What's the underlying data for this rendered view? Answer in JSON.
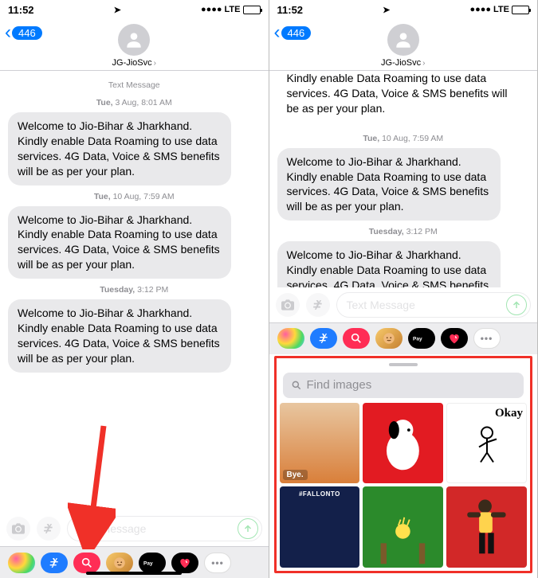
{
  "statusbar": {
    "time": "11:52",
    "network": "LTE"
  },
  "header": {
    "back_badge": "446",
    "contact_name": "JG-JioSvc"
  },
  "text_message_label": "Text Message",
  "timestamps": {
    "t1_day": "Tue,",
    "t1_rest": "3 Aug, 8:01 AM",
    "t2_day": "Tue,",
    "t2_rest": "10 Aug, 7:59 AM",
    "t3_day": "Tuesday,",
    "t3_rest": "3:12 PM"
  },
  "msg_body": "Welcome to Jio-Bihar & Jharkhand. Kindly enable Data Roaming to use data services. 4G Data, Voice & SMS benefits will be as per your plan.",
  "msg_body_cut": "Kindly enable Data Roaming to use data services. 4G Data, Voice & SMS benefits will be as per your plan.",
  "composer": {
    "placeholder": "Text Message"
  },
  "gif": {
    "search_placeholder": "Find images",
    "tiles": [
      {
        "caption": "Bye."
      },
      {
        "caption": ""
      },
      {
        "okay": "Okay"
      },
      {
        "caption": "#FALLONTO"
      },
      {
        "caption": ""
      },
      {
        "caption": ""
      }
    ]
  },
  "apptray_items": [
    "photos",
    "appstore",
    "gif-search",
    "memoji",
    "apple-pay",
    "digital-touch",
    "more"
  ]
}
